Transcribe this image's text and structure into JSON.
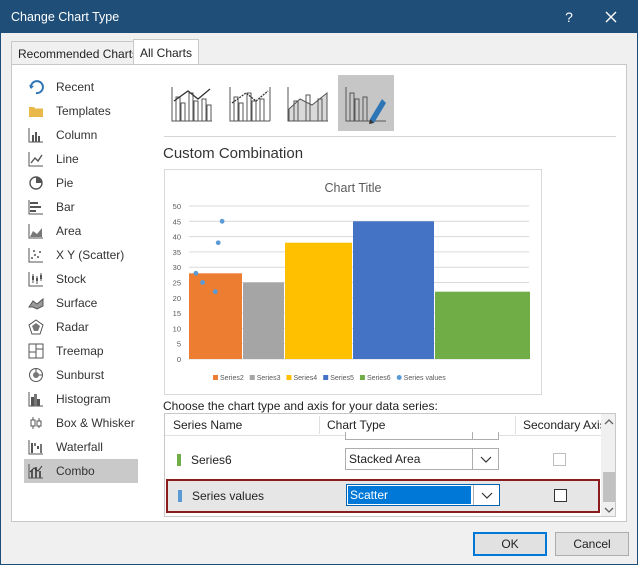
{
  "window": {
    "title": "Change Chart Type",
    "help_label": "?"
  },
  "tabs": [
    {
      "label": "Recommended Charts",
      "active": false
    },
    {
      "label": "All Charts",
      "active": true
    }
  ],
  "sidebar": {
    "items": [
      {
        "label": "Recent",
        "icon": "recent-icon"
      },
      {
        "label": "Templates",
        "icon": "templates-folder-icon"
      },
      {
        "label": "Column",
        "icon": "column-chart-icon"
      },
      {
        "label": "Line",
        "icon": "line-chart-icon"
      },
      {
        "label": "Pie",
        "icon": "pie-chart-icon"
      },
      {
        "label": "Bar",
        "icon": "bar-chart-icon"
      },
      {
        "label": "Area",
        "icon": "area-chart-icon"
      },
      {
        "label": "X Y (Scatter)",
        "icon": "scatter-chart-icon"
      },
      {
        "label": "Stock",
        "icon": "stock-chart-icon"
      },
      {
        "label": "Surface",
        "icon": "surface-chart-icon"
      },
      {
        "label": "Radar",
        "icon": "radar-chart-icon"
      },
      {
        "label": "Treemap",
        "icon": "treemap-chart-icon"
      },
      {
        "label": "Sunburst",
        "icon": "sunburst-chart-icon"
      },
      {
        "label": "Histogram",
        "icon": "histogram-chart-icon"
      },
      {
        "label": "Box & Whisker",
        "icon": "box-whisker-chart-icon"
      },
      {
        "label": "Waterfall",
        "icon": "waterfall-chart-icon"
      },
      {
        "label": "Combo",
        "icon": "combo-chart-icon",
        "selected": true
      }
    ]
  },
  "subtypes": [
    {
      "icon": "clustered-column-line-icon"
    },
    {
      "icon": "clustered-column-line-secondary-axis-icon"
    },
    {
      "icon": "stacked-area-clustered-column-icon"
    },
    {
      "icon": "custom-combination-icon",
      "selected": true
    }
  ],
  "main": {
    "section_title": "Custom Combination",
    "series_prompt": "Choose the chart type and axis for your data series:"
  },
  "chart_data": {
    "type": "combo",
    "title": "Chart Title",
    "ylim": [
      0,
      50
    ],
    "yticks": [
      0,
      5,
      10,
      15,
      20,
      25,
      30,
      35,
      40,
      45,
      50
    ],
    "grid": true,
    "legend_position": "bottom",
    "bars": [
      {
        "name": "Series2",
        "value": 28,
        "color": "#ed7d31"
      },
      {
        "name": "Series3",
        "value": 25,
        "color": "#a5a5a5"
      },
      {
        "name": "Series4",
        "value": 38,
        "color": "#ffc000"
      },
      {
        "name": "Series5",
        "value": 45,
        "color": "#4472c4"
      },
      {
        "name": "Series6",
        "value": 22,
        "color": "#70ad47"
      }
    ],
    "scatter": {
      "name": "Series values",
      "color": "#5b9bd5",
      "points": [
        {
          "x": 0.5,
          "y": 28
        },
        {
          "x": 1.2,
          "y": 25
        },
        {
          "x": 2.5,
          "y": 22
        },
        {
          "x": 2.8,
          "y": 38
        },
        {
          "x": 3.2,
          "y": 45
        }
      ]
    }
  },
  "series_table": {
    "headers": {
      "name": "Series Name",
      "type": "Chart Type",
      "axis": "Secondary Axis"
    },
    "rows": [
      {
        "name": "Series6",
        "color": "#70ad47",
        "chart_type": "Stacked Area",
        "secondary_axis": false,
        "axis_enabled": false
      },
      {
        "name": "Series values",
        "color": "#5b9bd5",
        "chart_type": "Scatter",
        "secondary_axis": false,
        "axis_enabled": true,
        "selected": true
      }
    ]
  },
  "buttons": {
    "ok": "OK",
    "cancel": "Cancel"
  }
}
